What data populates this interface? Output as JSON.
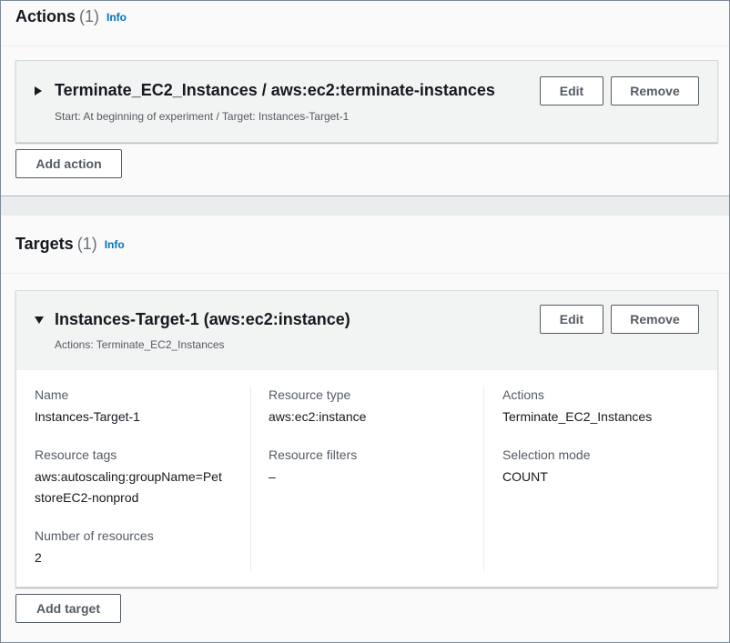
{
  "actions_section": {
    "title": "Actions",
    "count": "(1)",
    "info": "Info",
    "card": {
      "title": "Terminate_EC2_Instances / aws:ec2:terminate-instances",
      "subtitle": "Start: At beginning of experiment / Target: Instances-Target-1",
      "edit_label": "Edit",
      "remove_label": "Remove"
    },
    "add_label": "Add action"
  },
  "targets_section": {
    "title": "Targets",
    "count": "(1)",
    "info": "Info",
    "card": {
      "title": "Instances-Target-1 (aws:ec2:instance)",
      "subtitle": "Actions: Terminate_EC2_Instances",
      "edit_label": "Edit",
      "remove_label": "Remove",
      "fields": {
        "name_label": "Name",
        "name_value": "Instances-Target-1",
        "resource_tags_label": "Resource tags",
        "resource_tags_value_line1": "aws:autoscaling:groupName=Pet",
        "resource_tags_value_line2": "storeEC2-nonprod",
        "number_label": "Number of resources",
        "number_value": "2",
        "resource_type_label": "Resource type",
        "resource_type_value": "aws:ec2:instance",
        "resource_filters_label": "Resource filters",
        "resource_filters_value": "–",
        "actions_label": "Actions",
        "actions_value": "Terminate_EC2_Instances",
        "selection_mode_label": "Selection mode",
        "selection_mode_value": "COUNT"
      }
    },
    "add_label": "Add target"
  },
  "icons": {
    "collapsed": "caret-right-icon",
    "expanded": "caret-down-icon"
  },
  "colors": {
    "info_link": "#0073bb",
    "button_border": "#545b64",
    "header_bg": "#fafafa",
    "card_header_bg": "#f2f3f3"
  }
}
